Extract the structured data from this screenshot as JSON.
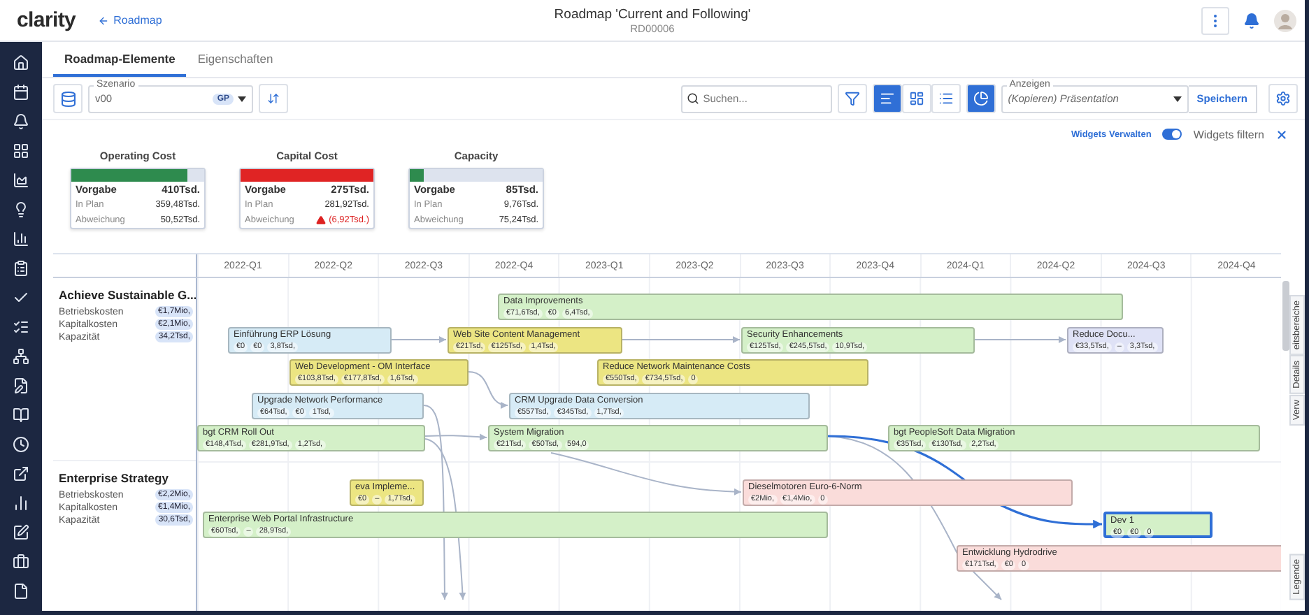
{
  "header": {
    "logo": "clarity",
    "back_link": "Roadmap",
    "title": "Roadmap 'Current and Following'",
    "code": "RD00006"
  },
  "tabs": [
    {
      "label": "Roadmap-Elemente",
      "selected": true
    },
    {
      "label": "Eigenschaften",
      "selected": false
    }
  ],
  "toolbar": {
    "scenario": {
      "label": "Szenario",
      "value": "v00",
      "chip": "GP"
    },
    "search": {
      "placeholder": "Suchen..."
    },
    "views": [
      {
        "selected": true
      },
      {
        "selected": false
      },
      {
        "selected": false
      }
    ],
    "widgets_on": true,
    "view_select": {
      "label": "Anzeigen",
      "value": "(Kopieren) Präsentation"
    },
    "save": "Speichern"
  },
  "widgets_bar": {
    "manage": "Widgets Verwalten",
    "filter": {
      "label": "Widgets filtern",
      "on": true
    }
  },
  "widgets": [
    {
      "title": "Operating Cost",
      "level": 0.87,
      "color": "#2e8b4e",
      "warning": false,
      "rows": [
        {
          "label": "Vorgabe",
          "value": "410Tsd."
        },
        {
          "label": "In Plan",
          "value": "359,48Tsd."
        },
        {
          "label": "Abweichung",
          "value": "50,52Tsd."
        }
      ]
    },
    {
      "title": "Capital Cost",
      "level": 1,
      "color": "#e02424",
      "warning": true,
      "rows": [
        {
          "label": "Vorgabe",
          "value": "275Tsd."
        },
        {
          "label": "In Plan",
          "value": "281,92Tsd."
        },
        {
          "label": "Abweichung",
          "value": "(6,92Tsd.)"
        }
      ]
    },
    {
      "title": "Capacity",
      "level": 0.11,
      "color": "#2e8b4e",
      "warning": false,
      "rows": [
        {
          "label": "Vorgabe",
          "value": "85Tsd."
        },
        {
          "label": "In Plan",
          "value": "9,76Tsd."
        },
        {
          "label": "Abweichung",
          "value": "75,24Tsd."
        }
      ]
    }
  ],
  "timeline": {
    "quarters": [
      "2022-Q1",
      "2022-Q2",
      "2022-Q3",
      "2022-Q4",
      "2023-Q1",
      "2023-Q2",
      "2023-Q3",
      "2023-Q4",
      "2024-Q1",
      "2024-Q2",
      "2024-Q3",
      "2024-Q4"
    ],
    "lanes": [
      {
        "title": "Achieve Sustainable G...",
        "metrics": [
          {
            "label": "Betriebskosten",
            "value": "€1,7Mio,"
          },
          {
            "label": "Kapitalkosten",
            "value": "€2,1Mio,"
          },
          {
            "label": "Kapazität",
            "value": "34,2Tsd,"
          }
        ],
        "bars": [
          {
            "name": "Data Improvements",
            "color": "#d4f0c8",
            "selected": false,
            "values": [
              "€71,6Tsd,",
              "€0",
              "6,4Tsd,"
            ]
          },
          {
            "name": "Einführung ERP Lösung",
            "color": "#d6ebf6",
            "selected": false,
            "values": [
              "€0",
              "€0",
              "3,8Tsd,"
            ]
          },
          {
            "name": "Web Site Content Management",
            "color": "#ece582",
            "selected": false,
            "values": [
              "€21Tsd,",
              "€125Tsd,",
              "1,4Tsd,"
            ]
          },
          {
            "name": "Security Enhancements",
            "color": "#d4f0c8",
            "selected": false,
            "values": [
              "€125Tsd,",
              "€245,5Tsd,",
              "10,9Tsd,"
            ]
          },
          {
            "name": "Reduce Docu...",
            "color": "#dfe2f6",
            "selected": false,
            "values": [
              "€33,5Tsd,",
              "–",
              "3,3Tsd,"
            ]
          },
          {
            "name": "Web Development - OM Interface",
            "color": "#ece582",
            "selected": false,
            "values": [
              "€103,8Tsd,",
              "€177,8Tsd,",
              "1,6Tsd,"
            ]
          },
          {
            "name": "Reduce Network Maintenance Costs",
            "color": "#ece582",
            "selected": false,
            "values": [
              "€550Tsd,",
              "€734,5Tsd,",
              "0"
            ]
          },
          {
            "name": "Upgrade Network Performance",
            "color": "#d6ebf6",
            "selected": false,
            "values": [
              "€64Tsd,",
              "€0",
              "1Tsd,"
            ]
          },
          {
            "name": "CRM Upgrade Data Conversion",
            "color": "#d6ebf6",
            "selected": false,
            "values": [
              "€557Tsd,",
              "€345Tsd,",
              "1,7Tsd,"
            ]
          },
          {
            "name": "bgt CRM Roll Out",
            "color": "#d4f0c8",
            "selected": false,
            "values": [
              "€148,4Tsd,",
              "€281,9Tsd,",
              "1,2Tsd,"
            ]
          },
          {
            "name": "System Migration",
            "color": "#d4f0c8",
            "selected": false,
            "values": [
              "€21Tsd,",
              "€50Tsd,",
              "594,0"
            ]
          },
          {
            "name": "bgt PeopleSoft Data Migration",
            "color": "#d4f0c8",
            "selected": false,
            "values": [
              "€35Tsd,",
              "€130Tsd,",
              "2,2Tsd,"
            ]
          }
        ]
      },
      {
        "title": "Enterprise Strategy",
        "metrics": [
          {
            "label": "Betriebskosten",
            "value": "€2,2Mio,"
          },
          {
            "label": "Kapitalkosten",
            "value": "€1,4Mio,"
          },
          {
            "label": "Kapazität",
            "value": "30,6Tsd,"
          }
        ],
        "bars": [
          {
            "name": "eva Impleme...",
            "color": "#ece582",
            "selected": false,
            "values": [
              "€0",
              "–",
              "1,7Tsd,"
            ]
          },
          {
            "name": "Dieselmotoren Euro-6-Norm",
            "color": "#fadcda",
            "selected": false,
            "values": [
              "€2Mio,",
              "€1,4Mio,",
              "0"
            ]
          },
          {
            "name": "Enterprise Web Portal Infrastructure",
            "color": "#d4f0c8",
            "selected": false,
            "values": [
              "€60Tsd,",
              "–",
              "28,9Tsd,"
            ]
          },
          {
            "name": "Dev 1",
            "color": "#d4f0c8",
            "selected": true,
            "values": [
              "€0",
              "€0",
              "0"
            ]
          },
          {
            "name": "Entwicklung Hydrodrive",
            "color": "#fadcda",
            "selected": false,
            "values": [
              "€171Tsd,",
              "€0",
              "0"
            ]
          }
        ]
      }
    ]
  },
  "side_tabs": [
    "eitsbereiche",
    "Details",
    "Verw"
  ],
  "legend_tab": "Legende"
}
